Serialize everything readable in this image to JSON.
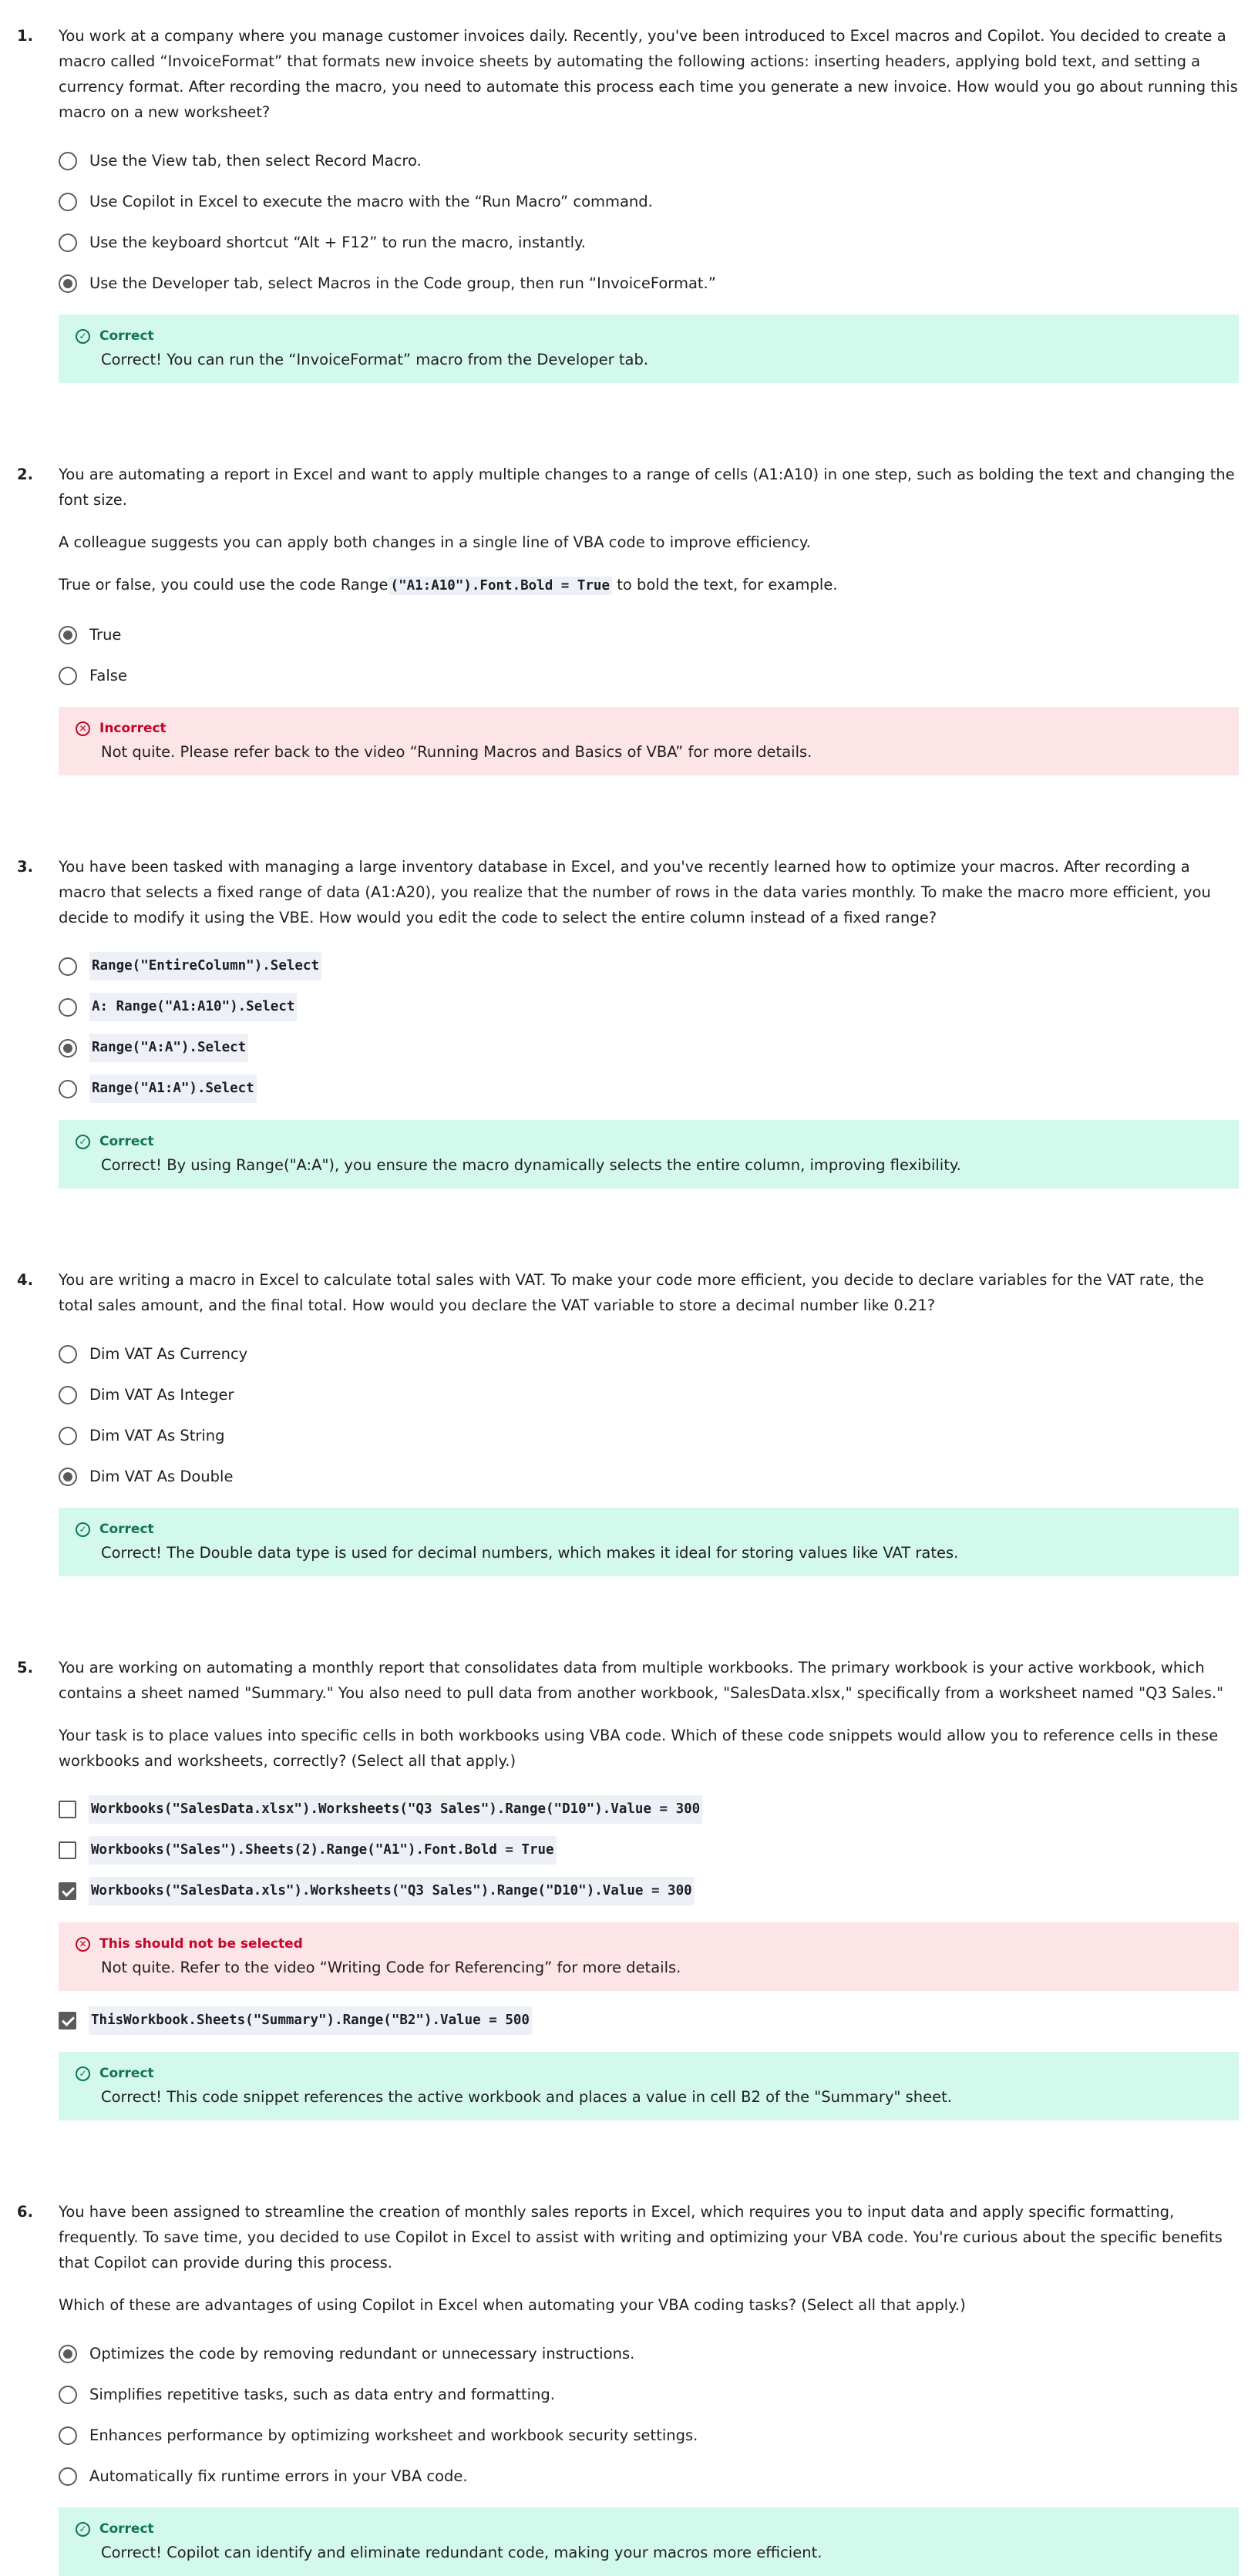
{
  "questions": [
    {
      "number": "1.",
      "prompt": "You work at a company where you manage customer invoices daily. Recently, you've been introduced to Excel macros and Copilot. You decided to create a macro called “InvoiceFormat” that formats new invoice sheets by automating the following actions: inserting headers, applying bold text, and setting a currency format. After recording the macro, you need to automate this process each time you generate a new invoice. How would you go about running this macro on a new worksheet?",
      "options": [
        "Use the View tab, then select Record Macro.",
        "Use Copilot in Excel to execute the macro with the “Run Macro” command.",
        "Use the keyboard shortcut “Alt + F12” to run the macro, instantly.",
        "Use the Developer tab, select Macros in the Code group, then run “InvoiceFormat.”"
      ],
      "feedback": {
        "status": "Correct",
        "text": "Correct! You can run the “InvoiceFormat” macro from the Developer tab."
      }
    },
    {
      "number": "2.",
      "prompt": "You are automating a report in Excel and want to apply multiple changes to a range of cells (A1:A10) in one step, such as bolding the text and changing the font size.",
      "prompt2": "A colleague suggests you can apply both changes in a single line of VBA code to improve efficiency.",
      "prompt3_before": "True or false, you could use the code Range",
      "prompt3_code": "(\"A1:A10\").Font.Bold = True",
      "prompt3_after": " to bold the text, for example.",
      "options": [
        "True",
        "False"
      ],
      "feedback": {
        "status": "Incorrect",
        "text": "Not quite. Please refer back to the video “Running Macros and Basics of VBA” for more details."
      }
    },
    {
      "number": "3.",
      "prompt": "You have been tasked with managing a large inventory database in Excel, and you've recently learned how to optimize your macros. After recording a macro that selects a fixed range of data (A1:A20), you realize that the number of rows in the data varies monthly. To make the macro more efficient, you decide to modify it using the VBE. How would you edit the code to select the entire column instead of a fixed range?",
      "options": [
        "Range(\"EntireColumn\").Select",
        "A: Range(\"A1:A10\").Select",
        "Range(\"A:A\").Select",
        "Range(\"A1:A\").Select"
      ],
      "feedback": {
        "status": "Correct",
        "text": "Correct! By using Range(\"A:A\"), you ensure the macro dynamically selects the entire column, improving flexibility."
      }
    },
    {
      "number": "4.",
      "prompt": "You are writing a macro in Excel to calculate total sales with VAT. To make your code more efficient, you decide to declare variables for the VAT rate, the total sales amount, and the final total. How would you declare the VAT variable to store a decimal number like 0.21?",
      "options": [
        "Dim VAT As Currency",
        "Dim VAT As Integer",
        "Dim VAT As String",
        "Dim VAT As Double"
      ],
      "feedback": {
        "status": "Correct",
        "text": "Correct! The Double data type is used for decimal numbers, which makes it ideal for storing values like VAT rates."
      }
    },
    {
      "number": "5.",
      "prompt": "You are working on automating a monthly report that consolidates data from multiple workbooks. The primary workbook is your active workbook, which contains a sheet named \"Summary.\" You also need to pull data from another workbook, \"SalesData.xlsx,\" specifically from a worksheet named \"Q3 Sales.\"",
      "prompt2": "Your task is to place values into specific cells in both workbooks using VBA code. Which of these code snippets would allow you to reference cells in these workbooks and worksheets, correctly? (Select all that apply.)",
      "options": [
        "Workbooks(\"SalesData.xlsx\").Worksheets(\"Q3 Sales\").Range(\"D10\").Value = 300",
        "Workbooks(\"Sales\").Sheets(2).Range(\"A1\").Font.Bold = True",
        "Workbooks(\"SalesData.xls\").Worksheets(\"Q3 Sales\").Range(\"D10\").Value = 300",
        "ThisWorkbook.Sheets(\"Summary\").Range(\"B2\").Value = 500"
      ],
      "feedback_a": {
        "status": "This should not be selected",
        "text": "Not quite. Refer to the video “Writing Code for Referencing” for more details."
      },
      "feedback_b": {
        "status": "Correct",
        "text": "Correct! This code snippet references the active workbook and places a value in cell B2 of the \"Summary\" sheet."
      }
    },
    {
      "number": "6.",
      "prompt": "You have been assigned to streamline the creation of monthly sales reports in Excel, which requires you to input data and apply specific formatting, frequently. To save time, you decided to use Copilot in Excel to assist with writing and optimizing your VBA code. You're curious about the specific benefits that Copilot can provide during this process.",
      "prompt2": "Which of these are advantages of using Copilot in Excel when automating your VBA coding tasks? (Select all that apply.)",
      "options": [
        "Optimizes the code by removing redundant or unnecessary instructions.",
        "Simplifies repetitive tasks, such as data entry and formatting.",
        "Enhances performance by optimizing worksheet and workbook security settings.",
        "Automatically fix runtime errors in your VBA code."
      ],
      "feedback": {
        "status": "Correct",
        "text": "Correct! Copilot can identify and eliminate redundant code, making your macros more efficient."
      }
    }
  ],
  "icons": {
    "correct": "check-circle-icon",
    "incorrect": "x-circle-icon"
  },
  "colors": {
    "correct_bg": "#d3f8ec",
    "correct_fg": "#137454",
    "incorrect_bg": "#fce4e7",
    "incorrect_fg": "#c3062a"
  }
}
